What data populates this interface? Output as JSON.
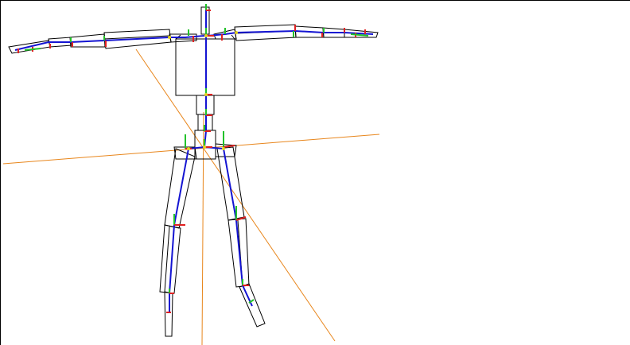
{
  "viewport": {
    "background": "#ffffff",
    "frame_color": "#000000"
  },
  "colors": {
    "grid_axis": "#e8861c",
    "bone_outline": "#000000",
    "bone_fill": "#ffffff",
    "skeleton_link": "#1414d2",
    "joint_axis_x": "#e02020",
    "joint_axis_y": "#22c22a",
    "joint_axis_z": "#1414d2",
    "joint_marker": "#e0d020"
  },
  "icons": {
    "joint_gizmo": "joint-axes-icon"
  }
}
